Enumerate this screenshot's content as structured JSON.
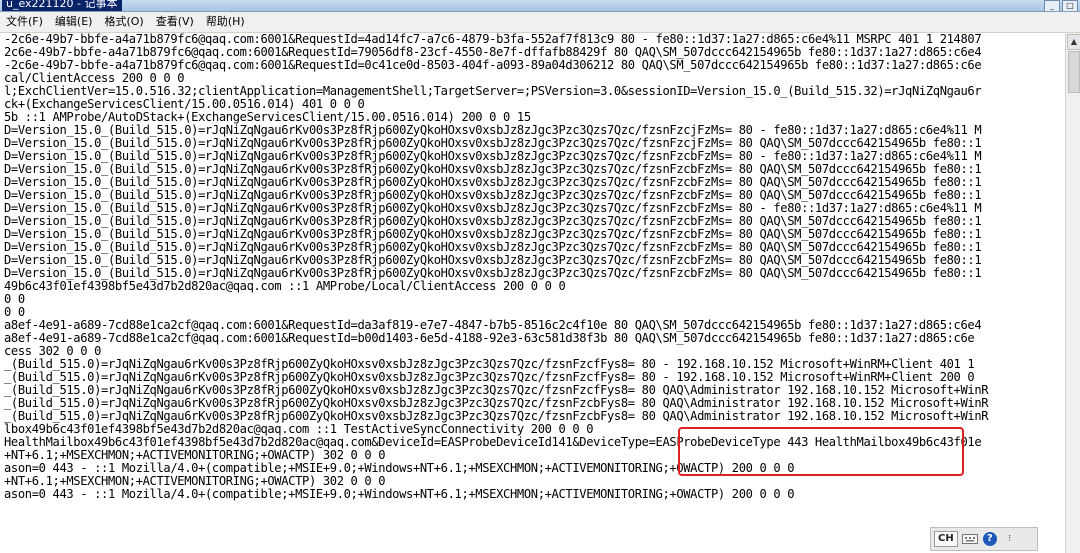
{
  "window": {
    "title": "u_ex221120 - 记事本"
  },
  "menu": {
    "file": "文件(F)",
    "edit": "编辑(E)",
    "format": "格式(O)",
    "view": "查看(V)",
    "help": "帮助(H)"
  },
  "lines": [
    "-2c6e-49b7-bbfe-a4a71b879fc6@qaq.com:6001&RequestId=4ad14fc7-a7c6-4879-b3fa-552af7f813c9 80 - fe80::1d37:1a27:d865:c6e4%11 MSRPC 401 1 214807",
    "2c6e-49b7-bbfe-a4a71b879fc6@qaq.com:6001&RequestId=79056df8-23cf-4550-8e7f-dffafb88429f 80 QAQ\\SM_507dccc642154965b fe80::1d37:1a27:d865:c6e4",
    "-2c6e-49b7-bbfe-a4a71b879fc6@qaq.com:6001&RequestId=0c41ce0d-8503-404f-a093-89a04d306212 80 QAQ\\SM_507dccc642154965b fe80::1d37:1a27:d865:c6e",
    "cal/ClientAccess 200 0 0 0",
    "l;ExchClientVer=15.0.516.32;clientApplication=ManagementShell;TargetServer=;PSVersion=3.0&sessionID=Version_15.0_(Build_515.32)=rJqNiZqNgau6r",
    "ck+(ExchangeServicesClient/15.00.0516.014) 401 0 0 0",
    "5b ::1 AMProbe/AutoDStack+(ExchangeServicesClient/15.00.0516.014) 200 0 0 15",
    "D=Version_15.0_(Build_515.0)=rJqNiZqNgau6rKv00s3Pz8fRjp600ZyQkoHOxsv0xsbJz8zJgc3Pzc3Qzs7Qzc/fzsnFzcjFzMs= 80 - fe80::1d37:1a27:d865:c6e4%11 M",
    "D=Version_15.0_(Build_515.0)=rJqNiZqNgau6rKv00s3Pz8fRjp600ZyQkoHOxsv0xsbJz8zJgc3Pzc3Qzs7Qzc/fzsnFzcjFzMs= 80 QAQ\\SM_507dccc642154965b fe80::1",
    "D=Version_15.0_(Build_515.0)=rJqNiZqNgau6rKv00s3Pz8fRjp600ZyQkoHOxsv0xsbJz8zJgc3Pzc3Qzs7Qzc/fzsnFzcbFzMs= 80 - fe80::1d37:1a27:d865:c6e4%11 M",
    "D=Version_15.0_(Build_515.0)=rJqNiZqNgau6rKv00s3Pz8fRjp600ZyQkoHOxsv0xsbJz8zJgc3Pzc3Qzs7Qzc/fzsnFzcbFzMs= 80 QAQ\\SM_507dccc642154965b fe80::1",
    "D=Version_15.0_(Build_515.0)=rJqNiZqNgau6rKv00s3Pz8fRjp600ZyQkoHOxsv0xsbJz8zJgc3Pzc3Qzs7Qzc/fzsnFzcbFzMs= 80 QAQ\\SM_507dccc642154965b fe80::1",
    "D=Version_15.0_(Build_515.0)=rJqNiZqNgau6rKv00s3Pz8fRjp600ZyQkoHOxsv0xsbJz8zJgc3Pzc3Qzs7Qzc/fzsnFzcbFzMs= 80 QAQ\\SM_507dccc642154965b fe80::1",
    "D=Version_15.0_(Build_515.0)=rJqNiZqNgau6rKv00s3Pz8fRjp600ZyQkoHOxsv0xsbJz8zJgc3Pzc3Qzs7Qzc/fzsnFzcbFzMs= 80 - fe80::1d37:1a27:d865:c6e4%11 M",
    "D=Version_15.0_(Build_515.0)=rJqNiZqNgau6rKv00s3Pz8fRjp600ZyQkoHOxsv0xsbJz8zJgc3Pzc3Qzs7Qzc/fzsnFzcbFzMs= 80 QAQ\\SM_507dccc642154965b fe80::1",
    "D=Version_15.0_(Build_515.0)=rJqNiZqNgau6rKv00s3Pz8fRjp600ZyQkoHOxsv0xsbJz8zJgc3Pzc3Qzs7Qzc/fzsnFzcbFzMs= 80 QAQ\\SM_507dccc642154965b fe80::1",
    "D=Version_15.0_(Build_515.0)=rJqNiZqNgau6rKv00s3Pz8fRjp600ZyQkoHOxsv0xsbJz8zJgc3Pzc3Qzs7Qzc/fzsnFzcbFzMs= 80 QAQ\\SM_507dccc642154965b fe80::1",
    "D=Version_15.0_(Build_515.0)=rJqNiZqNgau6rKv00s3Pz8fRjp600ZyQkoHOxsv0xsbJz8zJgc3Pzc3Qzs7Qzc/fzsnFzcbFzMs= 80 QAQ\\SM_507dccc642154965b fe80::1",
    "D=Version_15.0_(Build_515.0)=rJqNiZqNgau6rKv00s3Pz8fRjp600ZyQkoHOxsv0xsbJz8zJgc3Pzc3Qzs7Qzc/fzsnFzcbFzMs= 80 QAQ\\SM_507dccc642154965b fe80::1",
    "49b6c43f01ef4398bf5e43d7b2d820ac@qaq.com ::1 AMProbe/Local/ClientAccess 200 0 0 0",
    "0 0",
    "0 0",
    "a8ef-4e91-a689-7cd88e1ca2cf@qaq.com:6001&RequestId=da3af819-e7e7-4847-b7b5-8516c2c4f10e 80 QAQ\\SM_507dccc642154965b fe80::1d37:1a27:d865:c6e4",
    "a8ef-4e91-a689-7cd88e1ca2cf@qaq.com:6001&RequestId=b00d1403-6e5d-4188-92e3-63c581d38f3b 80 QAQ\\SM_507dccc642154965b fe80::1d37:1a27:d865:c6e",
    "cess 302 0 0 0",
    "_(Build_515.0)=rJqNiZqNgau6rKv00s3Pz8fRjp600ZyQkoHOxsv0xsbJz8zJgc3Pzc3Qzs7Qzc/fzsnFzcfFys8= 80 - 192.168.10.152 Microsoft+WinRM+Client 401 1",
    "_(Build_515.0)=rJqNiZqNgau6rKv00s3Pz8fRjp600ZyQkoHOxsv0xsbJz8zJgc3Pzc3Qzs7Qzc/fzsnFzcfFys8= 80 - 192.168.10.152 Microsoft+WinRM+Client 200 0",
    "_(Build_515.0)=rJqNiZqNgau6rKv00s3Pz8fRjp600ZyQkoHOxsv0xsbJz8zJgc3Pzc3Qzs7Qzc/fzsnFzcfFys8= 80 QAQ\\Administrator 192.168.10.152 Microsoft+WinR",
    "_(Build_515.0)=rJqNiZqNgau6rKv00s3Pz8fRjp600ZyQkoHOxsv0xsbJz8zJgc3Pzc3Qzs7Qzc/fzsnFzcbFys8= 80 QAQ\\Administrator 192.168.10.152 Microsoft+WinR",
    "_(Build_515.0)=rJqNiZqNgau6rKv00s3Pz8fRjp600ZyQkoHOxsv0xsbJz8zJgc3Pzc3Qzs7Qzc/fzsnFzcbFys8= 80 QAQ\\Administrator 192.168.10.152 Microsoft+WinR",
    "lbox49b6c43f01ef4398bf5e43d7b2d820ac@qaq.com ::1 TestActiveSyncConnectivity 200 0 0 0",
    "HealthMailbox49b6c43f01ef4398bf5e43d7b2d820ac@qaq.com&DeviceId=EASProbeDeviceId141&DeviceType=EASProbeDeviceType 443 HealthMailbox49b6c43f01e",
    "+NT+6.1;+MSEXCHMON;+ACTIVEMONITORING;+OWACTP) 302 0 0 0",
    "ason=0 443 - ::1 Mozilla/4.0+(compatible;+MSIE+9.0;+Windows+NT+6.1;+MSEXCHMON;+ACTIVEMONITORING;+OWACTP) 200 0 0 0",
    "+NT+6.1;+MSEXCHMON;+ACTIVEMONITORING;+OWACTP) 302 0 0 0",
    "ason=0 443 - ::1 Mozilla/4.0+(compatible;+MSIE+9.0;+Windows+NT+6.1;+MSEXCHMON;+ACTIVEMONITORING;+OWACTP) 200 0 0 0"
  ],
  "tray": {
    "ime": "CH",
    "help": "?"
  }
}
